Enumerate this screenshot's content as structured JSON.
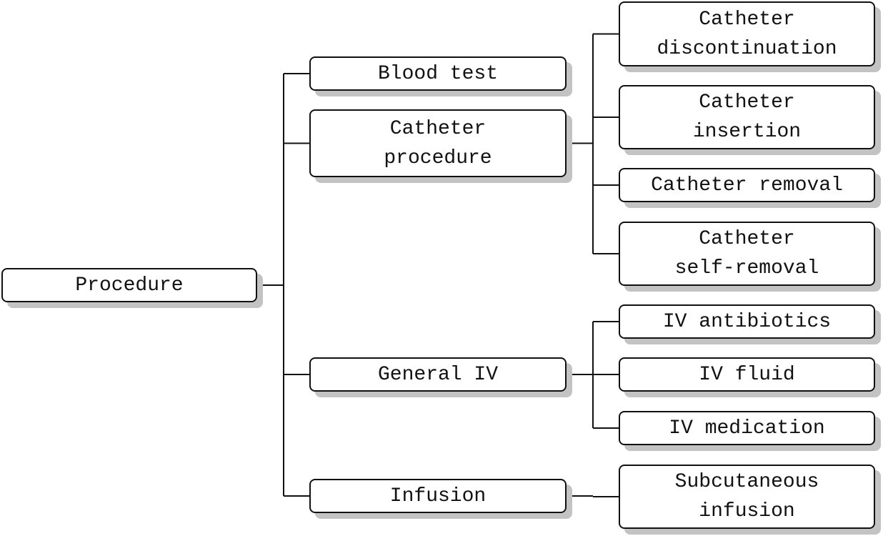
{
  "diagram": {
    "type": "tree",
    "root": {
      "id": "procedure",
      "label": "Procedure"
    },
    "level1": [
      {
        "id": "blood-test",
        "label": "Blood test",
        "children": []
      },
      {
        "id": "catheter-procedure",
        "label": "Catheter\nprocedure",
        "children": [
          "catheter-discontinuation",
          "catheter-insertion",
          "catheter-removal",
          "catheter-self-removal"
        ]
      },
      {
        "id": "general-iv",
        "label": "General IV",
        "children": [
          "iv-antibiotics",
          "iv-fluid",
          "iv-medication"
        ]
      },
      {
        "id": "infusion",
        "label": "Infusion",
        "children": [
          "subcutaneous-infusion"
        ]
      }
    ],
    "level2": [
      {
        "id": "catheter-discontinuation",
        "label": "Catheter\ndiscontinuation",
        "parent": "catheter-procedure"
      },
      {
        "id": "catheter-insertion",
        "label": "Catheter\ninsertion",
        "parent": "catheter-procedure"
      },
      {
        "id": "catheter-removal",
        "label": "Catheter removal",
        "parent": "catheter-procedure"
      },
      {
        "id": "catheter-self-removal",
        "label": "Catheter\nself-removal",
        "parent": "catheter-procedure"
      },
      {
        "id": "iv-antibiotics",
        "label": "IV antibiotics",
        "parent": "general-iv"
      },
      {
        "id": "iv-fluid",
        "label": "IV fluid",
        "parent": "general-iv"
      },
      {
        "id": "iv-medication",
        "label": "IV medication",
        "parent": "general-iv"
      },
      {
        "id": "subcutaneous-infusion",
        "label": "Subcutaneous\ninfusion",
        "parent": "infusion"
      }
    ],
    "colors": {
      "border": "#111111",
      "fill": "#ffffff",
      "shadow": "#c3c3c3",
      "text": "#111111"
    }
  }
}
